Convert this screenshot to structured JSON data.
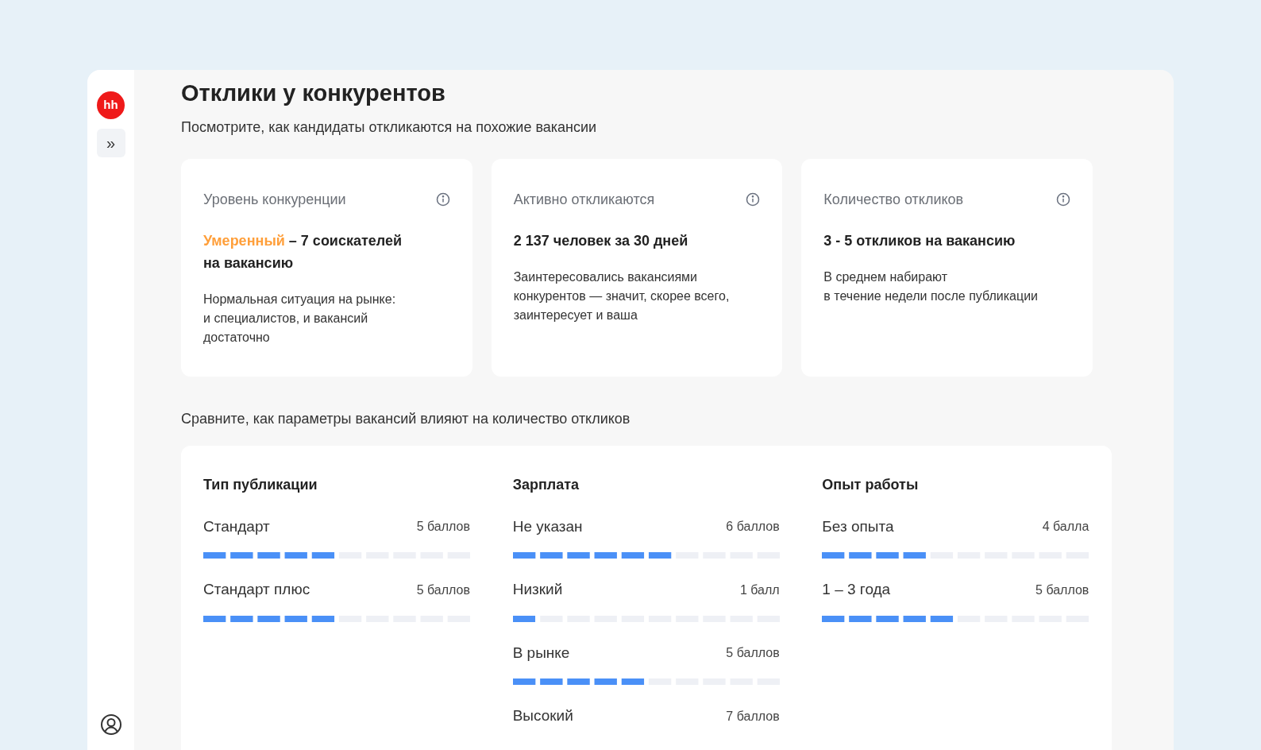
{
  "sidebar": {
    "logo": "hh",
    "expand": "»"
  },
  "title": "Отклики у конкурентов",
  "subtitle": "Посмотрите, как кандидаты откликаются на похожие вакансии",
  "cards": [
    {
      "label": "Уровень конкуренции",
      "highlight": {
        "text": "Умеренный",
        "color": "#ff9f3a"
      },
      "headline": "– 7 соискателей на вакансию",
      "description": "Нормальная ситуация на рынке:\nи специалистов, и вакансий\nдостаточно"
    },
    {
      "label": "Активно откликаются",
      "headline": "2 137 человек за 30 дней",
      "description": "Заинтересовались вакансиями\nконкурентов — значит, скорее всего,\nзаинтересует и ваша"
    },
    {
      "label": "Количество откликов",
      "headline": "3 - 5 откликов на вакансию",
      "description": "В среднем набирают\nв течение недели после публикации"
    }
  ],
  "compare_title": "Сравните, как параметры вакансий влияют на количество откликов",
  "groups": [
    {
      "title": "Тип публикации",
      "rows": [
        {
          "label": "Стандарт",
          "score": "5 баллов",
          "level": 0.5
        },
        {
          "label": "Стандарт плюс",
          "score": "5 баллов",
          "level": 0.5
        }
      ]
    },
    {
      "title": "Зарплата",
      "rows": [
        {
          "label": "Не указан",
          "score": "6 баллов",
          "level": 0.6
        },
        {
          "label": "Низкий",
          "score": "1 балл",
          "level": 0.1
        },
        {
          "label": "В рынке",
          "score": "5 баллов",
          "level": 0.5
        },
        {
          "label": "Высокий",
          "score": "7 баллов"
        }
      ]
    },
    {
      "title": "Опыт работы",
      "rows": [
        {
          "label": "Без опыта",
          "score": "4 балла",
          "level": 0.4
        },
        {
          "label": "1 – 3 года",
          "score": "5 баллов",
          "level": 0.5
        }
      ]
    }
  ]
}
